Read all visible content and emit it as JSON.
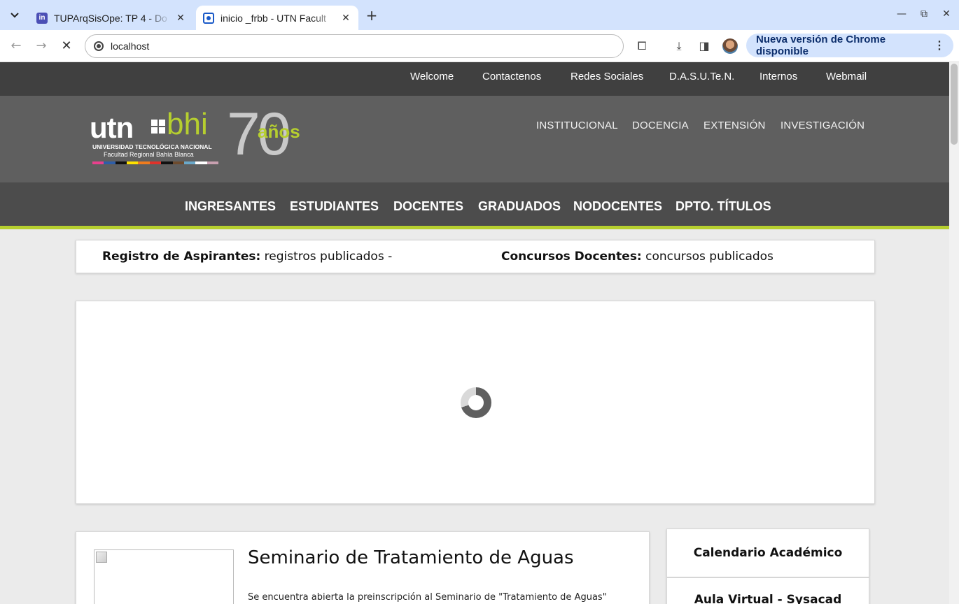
{
  "browser": {
    "tabs": [
      {
        "title": "TUPArqSisOpe: TP 4 - Do",
        "favicon": "in-logo-icon",
        "active": false
      },
      {
        "title": "inicio _frbb - UTN Facult",
        "favicon": "utn-globe-icon",
        "active": true
      }
    ],
    "address": "localhost",
    "update_button": "Nueva versión de Chrome disponible"
  },
  "site": {
    "top_links": [
      "Welcome",
      "Contactenos",
      "Redes Sociales",
      "D.A.S.U.Te.N.",
      "Internos",
      "Webmail"
    ],
    "logo": {
      "utn": "utn",
      "bhi": "bhi",
      "university": "UNIVERSIDAD TECNOLÓGICA NACIONAL",
      "faculty": "Facultad Regional Bahía Blanca",
      "anniversary_number": "70",
      "anniversary_word": "años"
    },
    "header_links": [
      "INSTITUCIONAL",
      "DOCENCIA",
      "EXTENSIÓN",
      "INVESTIGACIÓN"
    ],
    "main_nav": [
      "INGRESANTES",
      "ESTUDIANTES",
      "DOCENTES",
      "GRADUADOS",
      "NODOCENTES",
      "DPTO. TÍTULOS"
    ],
    "ticker": [
      {
        "label": "Registro de Aspirantes:",
        "text": " registros publicados -"
      },
      {
        "label": "Concursos Docentes:",
        "text": " concursos publicados"
      }
    ],
    "news": {
      "title": "Seminario de Tratamiento de Aguas",
      "excerpt": "Se encuentra abierta la preinscripción al Seminario de \"Tratamiento de Aguas\""
    },
    "sidebar": [
      "Calendario Académico",
      "Aula Virtual - Sysacad"
    ]
  },
  "colors": {
    "accent": "#b6cf2f",
    "topbar": "#404040",
    "header": "#5f5f5f",
    "nav": "#4c4c4c",
    "chrome_tabstrip": "#d3e3fd"
  }
}
